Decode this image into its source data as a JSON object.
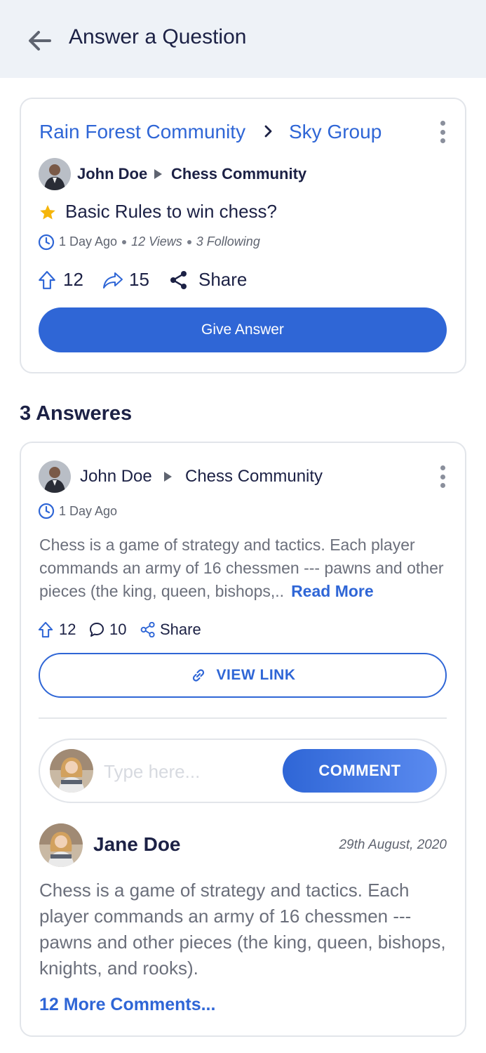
{
  "header": {
    "title": "Answer a Question",
    "back_icon": "arrow-left-icon"
  },
  "question": {
    "breadcrumb": [
      "Rain Forest Community",
      "Sky Group"
    ],
    "author": "John Doe",
    "community": "Chess Community",
    "title": "Basic Rules to win chess?",
    "time": "1 Day Ago",
    "views": "12 Views",
    "following": "3 Following",
    "upvotes": "12",
    "forwards": "15",
    "share_label": "Share",
    "give_answer_label": "Give Answer"
  },
  "answers_title": "3 Answeres",
  "answer": {
    "author": "John Doe",
    "community": "Chess Community",
    "time": "1 Day Ago",
    "text": "Chess is a game of strategy and tactics. Each player commands an army of 16 chessmen --- pawns and other pieces (the king, queen, bishops,..",
    "read_more": "Read More",
    "upvotes": "12",
    "comments": "10",
    "share_label": "Share",
    "view_link_label": "VIEW LINK",
    "comment_placeholder": "Type here...",
    "comment_button": "COMMENT"
  },
  "comment": {
    "author": "Jane Doe",
    "date": "29th August, 2020",
    "text": "Chess is a game of strategy and tactics. Each player commands an army of 16 chessmen --- pawns and other pieces (the king, queen, bishops, knights, and rooks).",
    "more_comments": "12 More Comments..."
  },
  "colors": {
    "accent": "#2f66d6",
    "header_bg": "#eef2f7",
    "text_dark": "#1c2145",
    "text_muted": "#6b6f7b",
    "star": "#f5b50a"
  }
}
